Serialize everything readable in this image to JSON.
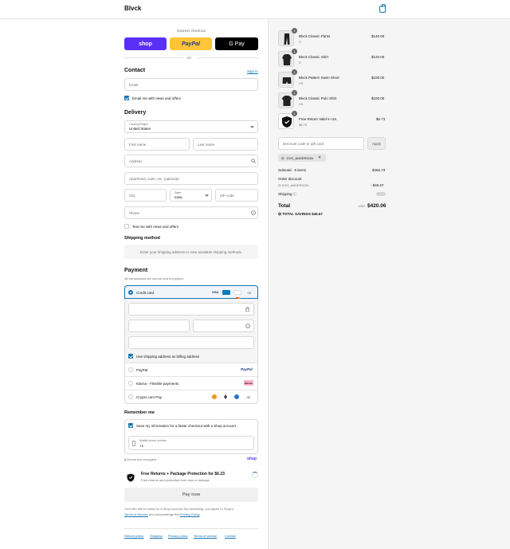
{
  "header": {
    "logo": "Blvck"
  },
  "express": {
    "title": "Express checkout",
    "shop": "shop",
    "paypal": "PayPal",
    "gpay": "G Pay",
    "or": "OR"
  },
  "contact": {
    "title": "Contact",
    "sign_in": "Sign in",
    "email_placeholder": "Email",
    "news_label": "Email me with news and offers"
  },
  "delivery": {
    "title": "Delivery",
    "country_label": "Country/Region",
    "country_value": "United States",
    "first_name": "First name",
    "last_name": "Last name",
    "address": "Address",
    "apartment": "Apartment, suite, etc. (optional)",
    "city": "City",
    "state_label": "State",
    "state_value": "Iowa",
    "zip": "ZIP code",
    "phone": "Phone",
    "text_label": "Text me with news and offers"
  },
  "shipping": {
    "title": "Shipping method",
    "placeholder": "Enter your shipping address to view available shipping methods."
  },
  "payment": {
    "title": "Payment",
    "subtitle": "All transactions are secure and encrypted.",
    "credit_card": "Credit card",
    "more_cards": "+3",
    "billing_label": "Use shipping address as billing address",
    "paypal": "PayPal",
    "paypal_logo": "PayPal",
    "klarna": "Klarna - Flexible payments",
    "klarna_logo": "Klarna.",
    "crypto": "Crypto.com Pay",
    "crypto_more": "+8"
  },
  "remember": {
    "title": "Remember me",
    "save_label": "Save my information for a faster checkout with a Shop account",
    "mobile_label": "Mobile phone number",
    "mobile_value": "+1",
    "secure": "Secure and encrypted",
    "shop": "shop"
  },
  "protection": {
    "title": "Free Returns + Package Protection for $6.23",
    "subtitle": "Free returns and protection from loss or damage"
  },
  "pay": {
    "label": "Pay now"
  },
  "legal": {
    "line1": "Your info will be saved to a Shop account. By continuing, you agree to Shop's",
    "tos": "Terms of Service",
    "and": "and acknowledge the",
    "privacy": "Privacy Policy",
    "end": "."
  },
  "footer": {
    "links": [
      "Refund policy",
      "Shipping",
      "Privacy policy",
      "Terms of service",
      "Contact"
    ]
  },
  "cart": {
    "items": [
      {
        "name": "Blvck Classic Pants",
        "variant": "S",
        "price": "$140.00",
        "qty": "1"
      },
      {
        "name": "Blvck Classic Shirt",
        "variant": "S",
        "price": "$120.00",
        "qty": "1"
      },
      {
        "name": "Blvck Pattern Swim Short",
        "variant": "XS",
        "price": "$100.00",
        "qty": "1"
      },
      {
        "name": "Blvck Classic Polo Shirt",
        "variant": "XS",
        "price": "$100.00",
        "qty": "1"
      },
      {
        "name": "Free Return Valid in US.",
        "variant": "$6.73",
        "price": "$6.73",
        "qty": "1"
      }
    ],
    "discount_placeholder": "Discount code or gift card",
    "apply": "Apply",
    "code": "DVO_ANDERSON",
    "subtotal_label": "Subtotal · 5 items",
    "subtotal": "$466.73",
    "order_discount_label": "Order discount",
    "discount_code": "DVO_ANDERSON",
    "discount_value": "- $46.67",
    "shipping_label": "Shipping",
    "total_label": "Total",
    "currency": "USD",
    "total": "$420.06",
    "savings_label": "TOTAL SAVINGS",
    "savings": "$46.67"
  }
}
